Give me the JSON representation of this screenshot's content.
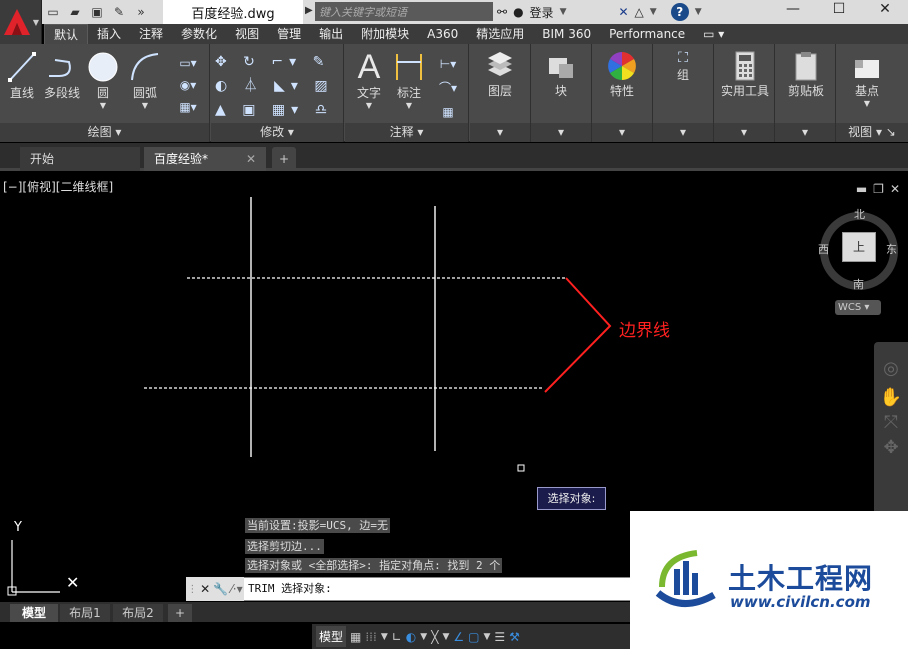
{
  "title_bar": {
    "document_title": "百度经验.dwg",
    "search_placeholder": "键入关键字或短语",
    "login_label": "登录",
    "help_icon": "?"
  },
  "ribbon_tabs": [
    "默认",
    "插入",
    "注释",
    "参数化",
    "视图",
    "管理",
    "输出",
    "附加模块",
    "A360",
    "精选应用",
    "BIM 360",
    "Performance"
  ],
  "ribbon": {
    "draw": {
      "line": "直线",
      "polyline": "多段线",
      "circle": "圆",
      "arc": "圆弧",
      "panel_title": "绘图"
    },
    "modify": {
      "panel_title": "修改"
    },
    "annotation": {
      "text": "文字",
      "dimension": "标注",
      "panel_title": "注释"
    },
    "layers": {
      "label": "图层"
    },
    "block": {
      "label": "块"
    },
    "properties": {
      "label": "特性"
    },
    "groups": {
      "label": "组"
    },
    "utilities": {
      "label": "实用工具"
    },
    "clipboard": {
      "label": "剪贴板"
    },
    "base": {
      "label": "基点"
    },
    "view_panel": {
      "panel_title": "视图"
    }
  },
  "file_tabs": {
    "start": "开始",
    "current": "百度经验*"
  },
  "viewport": {
    "label": "[−][俯视][二维线框]",
    "viewcube": {
      "north": "北",
      "south": "南",
      "east": "东",
      "west": "西",
      "top": "上",
      "wcs": "WCS"
    },
    "annotation": "边界线",
    "ucs_y": "Y"
  },
  "tooltip": "选择对象:",
  "command_history": [
    "当前设置:投影=UCS, 边=无",
    "选择剪切边...",
    "选择对象或 <全部选择>:  指定对角点: 找到 2 个"
  ],
  "command_line": "TRIM 选择对象:",
  "layout_tabs": [
    "模型",
    "布局1",
    "布局2"
  ],
  "status_bar": {
    "model": "模型"
  },
  "watermark": {
    "title": "土木工程网",
    "url": "www.civilcn.com"
  },
  "colors": {
    "accent_red": "#e0232b",
    "annotation": "#ff2020",
    "watermark_blue": "#1b4b9a"
  }
}
